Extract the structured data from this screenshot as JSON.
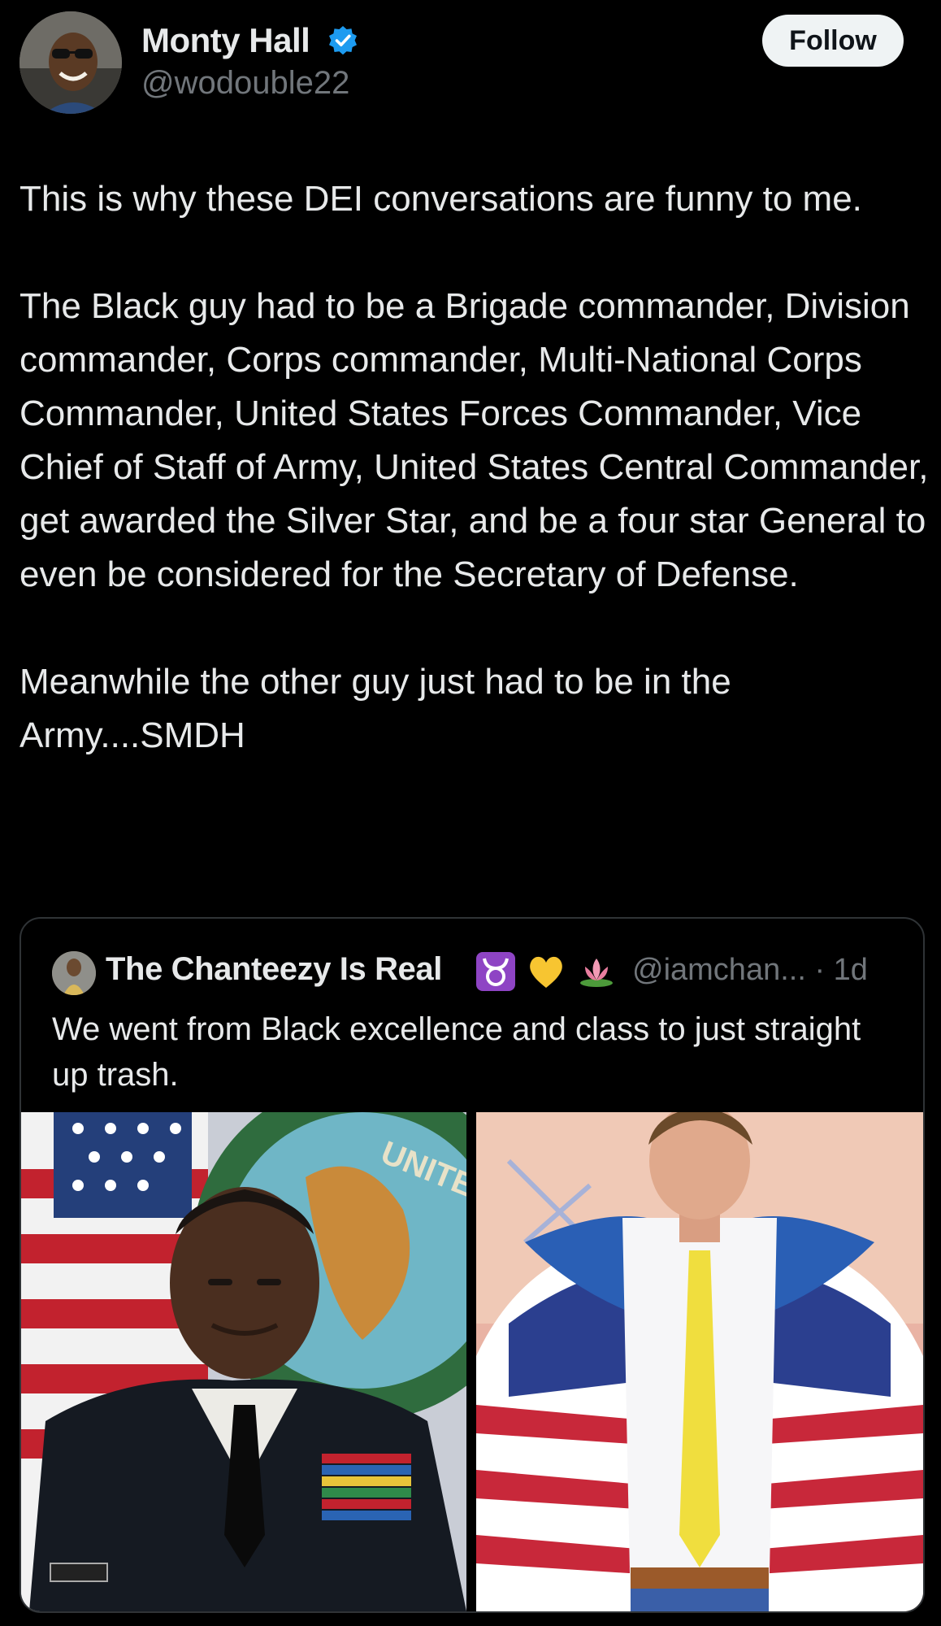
{
  "post": {
    "author": {
      "name": "Monty Hall",
      "handle": "@wodouble22",
      "verified": true
    },
    "follow_label": "Follow",
    "paragraphs": [
      "This is why these DEI conversations are funny to me.",
      "The Black guy had to be a Brigade commander, Division commander, Corps commander, Multi-National Corps Commander, United States Forces Commander, Vice Chief of Staff of Army, United States Central Commander, get awarded the Silver Star, and be a four star General to even be considered for the Secretary of Defense.",
      "Meanwhile the other guy just had to be in the Army....SMDH"
    ]
  },
  "quote": {
    "author": {
      "name": "The Chanteezy Is Real",
      "emojis": [
        "taurus-icon",
        "yellow-heart-icon",
        "lotus-icon"
      ],
      "handle": "@iamchan...",
      "time": "· 1d"
    },
    "text": "We went from Black excellence and class to just straight up trash.",
    "images": [
      {
        "name": "general-portrait-image",
        "emblem_text": "UNITED"
      },
      {
        "name": "man-flag-jacket-image"
      }
    ]
  },
  "colors": {
    "background": "#000000",
    "text_primary": "#e7e9ea",
    "text_secondary": "#71767b",
    "verified_blue": "#1d9bf0",
    "border": "#2f3336",
    "follow_bg": "#eff3f4"
  }
}
